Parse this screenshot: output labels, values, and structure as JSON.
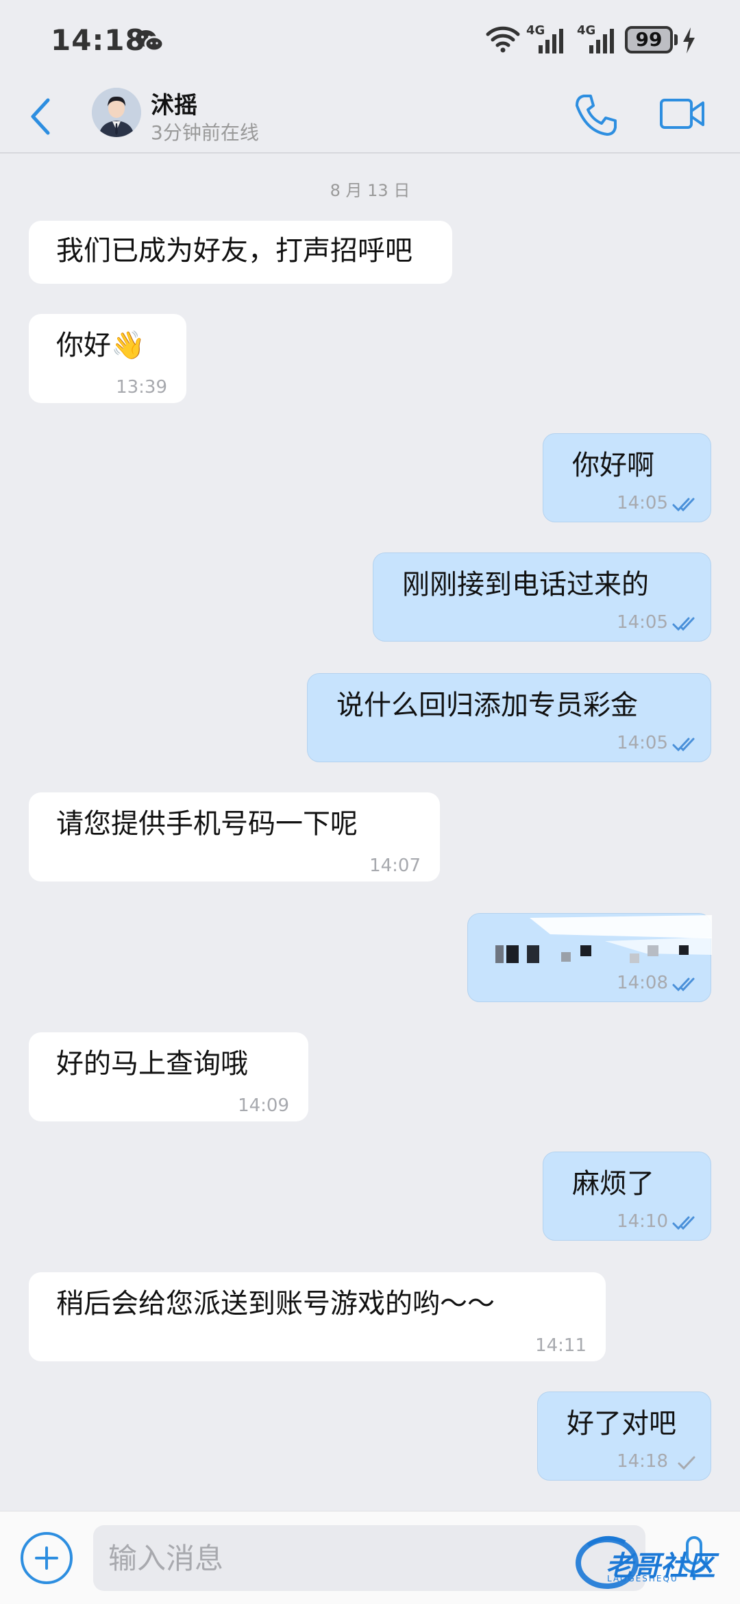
{
  "status_bar": {
    "time": "14:18",
    "network_1": "4G",
    "network_2": "4G",
    "battery": "99"
  },
  "header": {
    "contact_name": "沭摇",
    "contact_status": "3分钟前在线"
  },
  "date_separator": "8 月 13 日",
  "messages": [
    {
      "dir": "in",
      "text": "我们已成为好友，打声招呼吧",
      "time": ""
    },
    {
      "dir": "in",
      "text": "你好👋",
      "time": "13:39"
    },
    {
      "dir": "out",
      "text": "你好啊",
      "time": "14:05",
      "status": "read"
    },
    {
      "dir": "out",
      "text": "刚刚接到电话过来的",
      "time": "14:05",
      "status": "read"
    },
    {
      "dir": "out",
      "text": "说什么回归添加专员彩金",
      "time": "14:05",
      "status": "read"
    },
    {
      "dir": "in",
      "text": "请您提供手机号码一下呢",
      "time": "14:07"
    },
    {
      "dir": "out",
      "text": "",
      "time": "14:08",
      "status": "read",
      "redacted": true
    },
    {
      "dir": "in",
      "text": "好的马上查询哦",
      "time": "14:09"
    },
    {
      "dir": "out",
      "text": "麻烦了",
      "time": "14:10",
      "status": "read"
    },
    {
      "dir": "in",
      "text": "稍后会给您派送到账号游戏的哟～～",
      "time": "14:11"
    },
    {
      "dir": "out",
      "text": "好了对吧",
      "time": "14:18",
      "status": "sent"
    }
  ],
  "input": {
    "placeholder": "输入消息"
  },
  "watermark": {
    "text": "老哥社区",
    "sub": "LAOGESHEQU"
  },
  "colors": {
    "accent": "#2d8ee0",
    "outgoing_bubble": "#c7e3fd",
    "incoming_bubble": "#ffffff",
    "background": "#ecedf1"
  }
}
